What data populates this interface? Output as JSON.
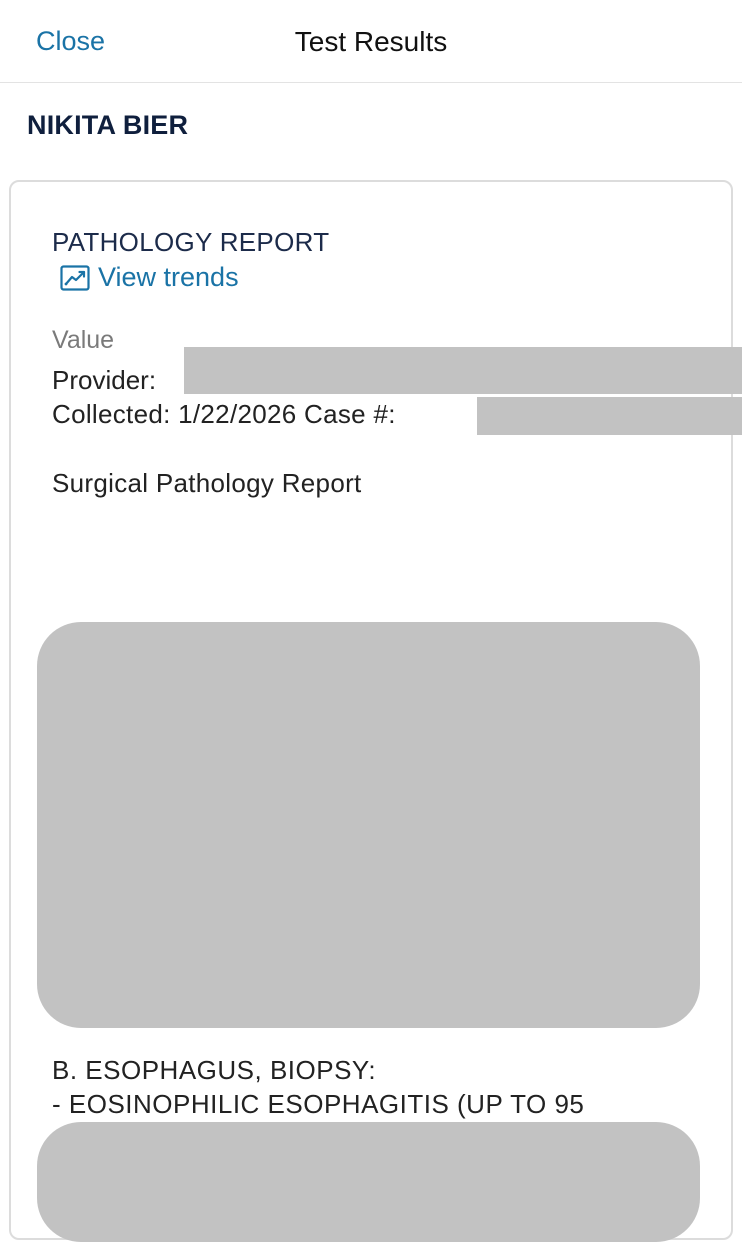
{
  "nav": {
    "close_label": "Close",
    "title": "Test Results"
  },
  "patient": {
    "name": "NIKITA BIER"
  },
  "report": {
    "title": "PATHOLOGY REPORT",
    "trends_label": "View trends",
    "trends_icon": "trend-chart-icon",
    "value_label": "Value",
    "provider_label": "Provider:",
    "collected_line": "Collected: 1/22/2026 Case #:",
    "report_type": "Surgical Pathology Report",
    "finding_title": "B. ESOPHAGUS, BIOPSY:",
    "finding_line": "- EOSINOPHILIC ESOPHAGITIS (UP TO 95"
  },
  "colors": {
    "link": "#1a73a6",
    "heading": "#0f1f3d",
    "redaction": "#c2c2c2",
    "muted": "#7a7a7a"
  }
}
